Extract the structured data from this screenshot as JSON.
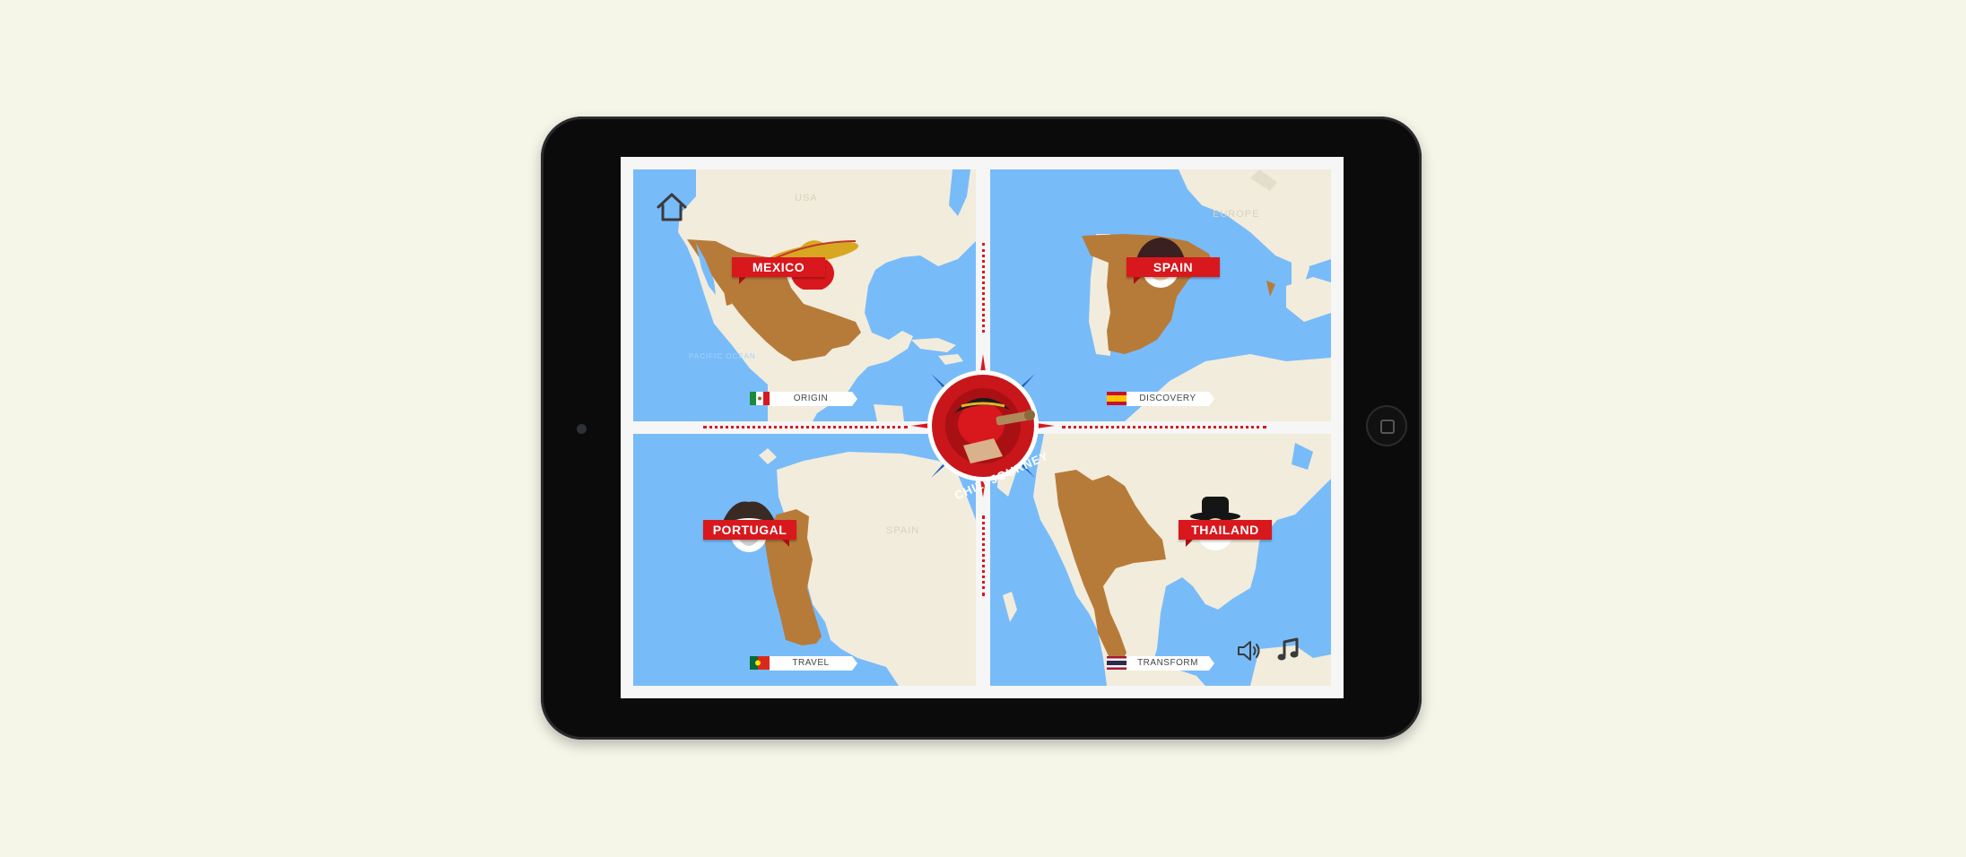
{
  "app": {
    "title": "CHILI JOURNEY"
  },
  "colors": {
    "accent": "#d8181d",
    "sea": "#78bbf9",
    "land": "#f2ecdc",
    "highlight": "#b77b39",
    "background": "#f5f5e8"
  },
  "toolbar": {
    "home_icon": "home-icon",
    "sound_icon": "speaker-icon",
    "music_icon": "music-note-icon"
  },
  "map_labels": {
    "usa": "USA",
    "europe": "EUROPE",
    "spain": "SPAIN",
    "pacific": "PACIFIC OCEAN"
  },
  "regions": [
    {
      "country": "MEXICO",
      "stage": "ORIGIN",
      "flag": "mexico-flag"
    },
    {
      "country": "SPAIN",
      "stage": "DISCOVERY",
      "flag": "spain-flag"
    },
    {
      "country": "PORTUGAL",
      "stage": "TRAVEL",
      "flag": "portugal-flag"
    },
    {
      "country": "THAILAND",
      "stage": "TRANSFORM",
      "flag": "thailand-flag"
    }
  ]
}
